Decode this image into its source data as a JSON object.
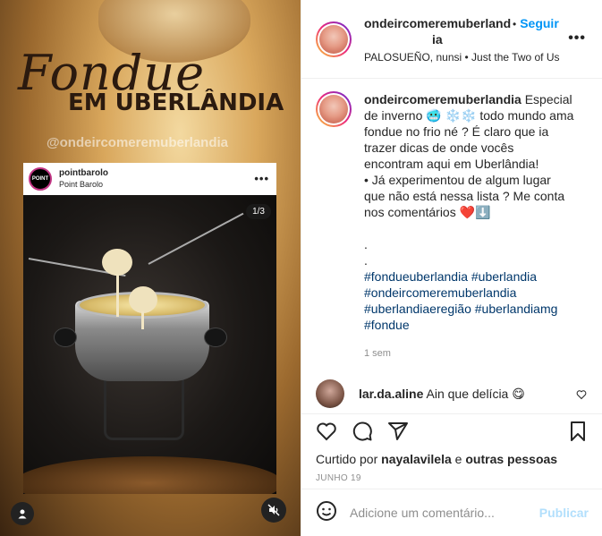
{
  "media": {
    "title": "Fondue",
    "subtitle": "EM UBERLÂNDIA",
    "handle": "@ondeircomeremuberlandia",
    "inner_post": {
      "avatar_text": "POINT",
      "username": "pointbarolo",
      "location": "Point Barolo",
      "counter": "1/3"
    }
  },
  "header": {
    "username_line1": "ondeircomeremuberland",
    "username_line2": "ia",
    "follow_label": "Seguir",
    "dot": "•",
    "subtitle": "PALOSUEÑO, nunsi • Just the Two of Us"
  },
  "caption": {
    "username": "ondeircomeremuberlandia",
    "text_1": "Especial de inverno 🥶 ❄️❄️ todo mundo ama fondue no frio né ? É claro que ia trazer dicas de onde vocês encontram aqui em Uberlândia!",
    "text_2": "• Já experimentou de algum lugar que não está nessa lista ? Me conta nos comentários ❤️⬇️",
    "dot1": ".",
    "dot2": ".",
    "hashtags": [
      "#fondueuberlandia",
      "#uberlandia",
      "#ondeircomeremuberlandia",
      "#uberlandiaeregião",
      "#uberlandiamg",
      "#fondue"
    ],
    "time": "1 sem"
  },
  "comment": {
    "username": "lar.da.aline",
    "text": "Ain que delícia 😋"
  },
  "actions": {
    "liked_prefix": "Curtido por",
    "liked_user": "nayalavilela",
    "liked_joiner": "e",
    "liked_others": "outras pessoas",
    "date": "JUNHO 19"
  },
  "add_comment": {
    "placeholder": "Adicione um comentário...",
    "publish_label": "Publicar"
  }
}
